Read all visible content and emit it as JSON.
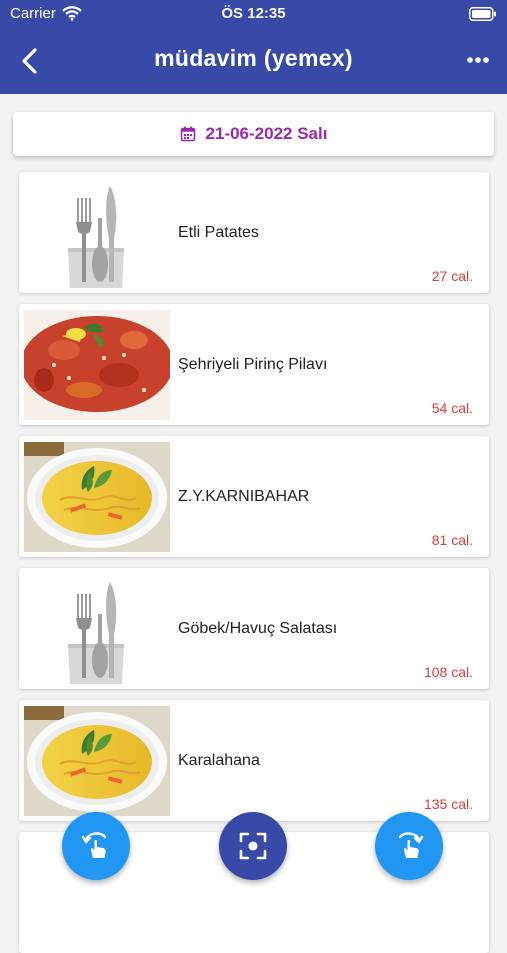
{
  "status_bar": {
    "carrier": "Carrier",
    "time": "ÖS 12:35",
    "wifi_icon": "wifi-icon",
    "battery_icon": "battery-icon"
  },
  "header": {
    "title": "müdavim (yemex)",
    "back_icon": "back-arrow-icon",
    "more_icon": "more-icon"
  },
  "date_picker": {
    "label": "21-06-2022 Salı",
    "icon": "calendar-icon"
  },
  "meals": [
    {
      "name": "Etli Patates",
      "calories": "27 cal.",
      "image": "cutlery"
    },
    {
      "name": "Şehriyeli Pirinç Pilavı",
      "calories": "54 cal.",
      "image": "rice-dish"
    },
    {
      "name": "Z.Y.KARNIBAHAR",
      "calories": "81 cal.",
      "image": "soup"
    },
    {
      "name": "Göbek/Havuç Salatası",
      "calories": "108 cal.",
      "image": "cutlery"
    },
    {
      "name": "Karalahana",
      "calories": "135 cal.",
      "image": "soup"
    }
  ],
  "fabs": [
    {
      "name": "swipe-left-button",
      "icon": "touch-rotate-left-icon",
      "color": "#2196f3"
    },
    {
      "name": "scan-button",
      "icon": "focus-scan-icon",
      "color": "#3849a8"
    },
    {
      "name": "swipe-right-button",
      "icon": "touch-rotate-right-icon",
      "color": "#2196f3"
    }
  ],
  "colors": {
    "header": "#3849a8",
    "date_text": "#9c27b0",
    "calories": "#e53935",
    "fab_blue": "#2196f3"
  }
}
